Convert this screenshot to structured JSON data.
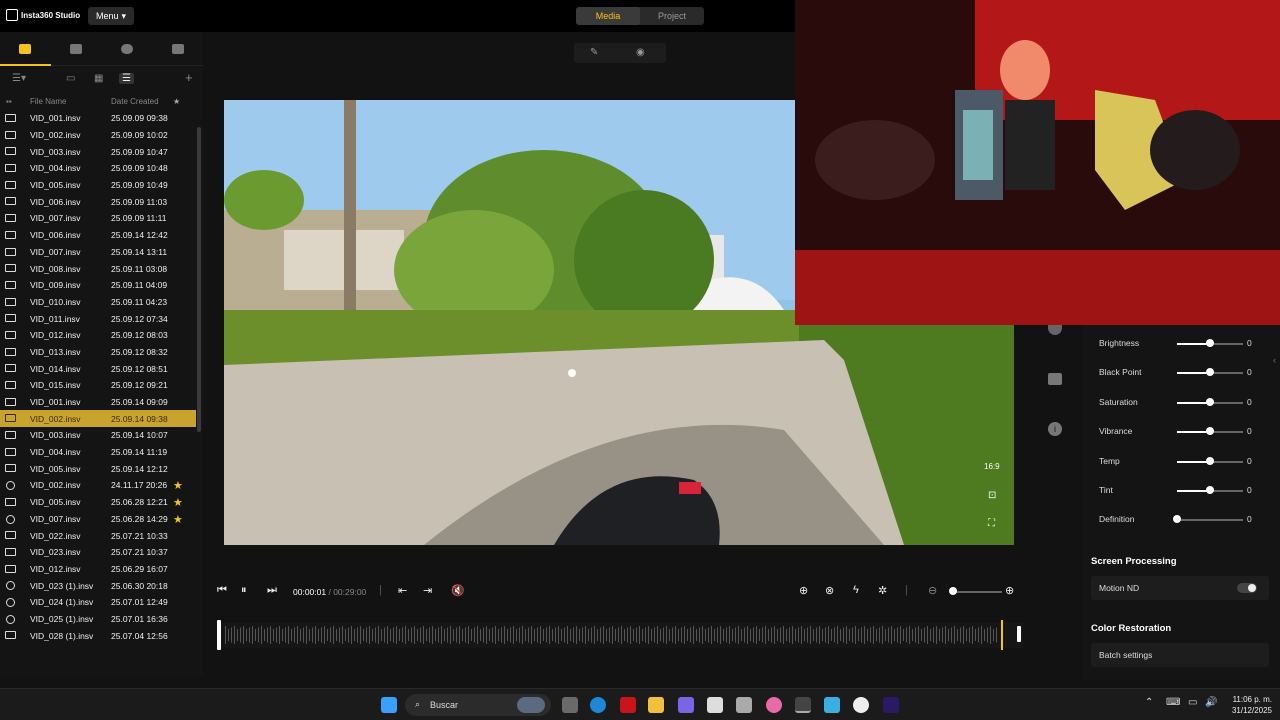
{
  "app": {
    "name": "Insta360 Studio",
    "menu_label": "Menu"
  },
  "top_tabs": [
    {
      "label": "Media",
      "active": true
    },
    {
      "label": "Project",
      "active": false
    }
  ],
  "left_tabs": [
    "monitor-icon",
    "album-icon",
    "cloud-icon",
    "folder-import-icon"
  ],
  "columns": {
    "name": "File Name",
    "date": "Date Created"
  },
  "files": [
    {
      "name": "VID_001.insv",
      "date": "25.09.09 09:38",
      "icon": "360"
    },
    {
      "name": "VID_002.insv",
      "date": "25.09.09 10:02",
      "icon": "360"
    },
    {
      "name": "VID_003.insv",
      "date": "25.09.09 10:47",
      "icon": "360"
    },
    {
      "name": "VID_004.insv",
      "date": "25.09.09 10:48",
      "icon": "360"
    },
    {
      "name": "VID_005.insv",
      "date": "25.09.09 10:49",
      "icon": "HDR"
    },
    {
      "name": "VID_006.insv",
      "date": "25.09.09 11:03",
      "icon": "360"
    },
    {
      "name": "VID_007.insv",
      "date": "25.09.09 11:11",
      "icon": "360"
    },
    {
      "name": "VID_006.insv",
      "date": "25.09.14 12:42",
      "icon": "360"
    },
    {
      "name": "VID_007.insv",
      "date": "25.09.14 13:11",
      "icon": "360"
    },
    {
      "name": "VID_008.insv",
      "date": "25.09.11 03:08",
      "icon": "HDR"
    },
    {
      "name": "VID_009.insv",
      "date": "25.09.11 04:09",
      "icon": "360"
    },
    {
      "name": "VID_010.insv",
      "date": "25.09.11 04:23",
      "icon": "HDR"
    },
    {
      "name": "VID_011.insv",
      "date": "25.09.12 07:34",
      "icon": "360"
    },
    {
      "name": "VID_012.insv",
      "date": "25.09.12 08:03",
      "icon": "360"
    },
    {
      "name": "VID_013.insv",
      "date": "25.09.12 08:32",
      "icon": "360"
    },
    {
      "name": "VID_014.insv",
      "date": "25.09.12 08:51",
      "icon": "360"
    },
    {
      "name": "VID_015.insv",
      "date": "25.09.12 09:21",
      "icon": "360"
    },
    {
      "name": "VID_001.insv",
      "date": "25.09.14 09:09",
      "icon": "360"
    },
    {
      "name": "VID_002.insv",
      "date": "25.09.14 09:38",
      "icon": "360",
      "selected": true
    },
    {
      "name": "VID_003.insv",
      "date": "25.09.14 10:07",
      "icon": "360"
    },
    {
      "name": "VID_004.insv",
      "date": "25.09.14 11:19",
      "icon": "360"
    },
    {
      "name": "VID_005.insv",
      "date": "25.09.14 12:12",
      "icon": "360"
    },
    {
      "name": "VID_002.insv",
      "date": "24.11.17 20:26",
      "icon": "clock",
      "star": true
    },
    {
      "name": "VID_005.insv",
      "date": "25.06.28 12:21",
      "icon": "360",
      "star": true
    },
    {
      "name": "VID_007.insv",
      "date": "25.06.28 14:29",
      "icon": "clock",
      "star": true
    },
    {
      "name": "VID_022.insv",
      "date": "25.07.21 10:33",
      "icon": "360"
    },
    {
      "name": "VID_023.insv",
      "date": "25.07.21 10:37",
      "icon": "360"
    },
    {
      "name": "VID_012.insv",
      "date": "25.06.29 16:07",
      "icon": "360"
    },
    {
      "name": "VID_023 (1).insv",
      "date": "25.06.30 20:18",
      "icon": "clock"
    },
    {
      "name": "VID_024 (1).insv",
      "date": "25.07.01 12:49",
      "icon": "clock"
    },
    {
      "name": "VID_025 (1).insv",
      "date": "25.07.01 16:36",
      "icon": "clock"
    },
    {
      "name": "VID_028 (1).insv",
      "date": "25.07.04 12:56",
      "icon": "360"
    }
  ],
  "player": {
    "current": "00:00:01",
    "total": "/ 00:29:00",
    "aspect": "16:9",
    "zoom_level": 0.05
  },
  "adjust": [
    {
      "label": "Brightness",
      "value": "0",
      "level": 0.5
    },
    {
      "label": "Black Point",
      "value": "0",
      "level": 0.5
    },
    {
      "label": "Saturation",
      "value": "0",
      "level": 0.5
    },
    {
      "label": "Vibrance",
      "value": "0",
      "level": 0.5
    },
    {
      "label": "Temp",
      "value": "0",
      "level": 0.5
    },
    {
      "label": "Tint",
      "value": "0",
      "level": 0.5
    },
    {
      "label": "Definition",
      "value": "0",
      "level": 0
    }
  ],
  "sections": {
    "screen_processing": "Screen Processing",
    "motion_nd": "Motion ND",
    "color_restoration": "Color Restoration",
    "batch_settings": "Batch settings"
  },
  "taskbar": {
    "search_placeholder": "Buscar",
    "time": "11:06 p. m.",
    "date": "31/12/2025"
  },
  "colors": {
    "accent": "#f5c31e",
    "selected_row": "#c8a42c",
    "panel": "#141414"
  }
}
